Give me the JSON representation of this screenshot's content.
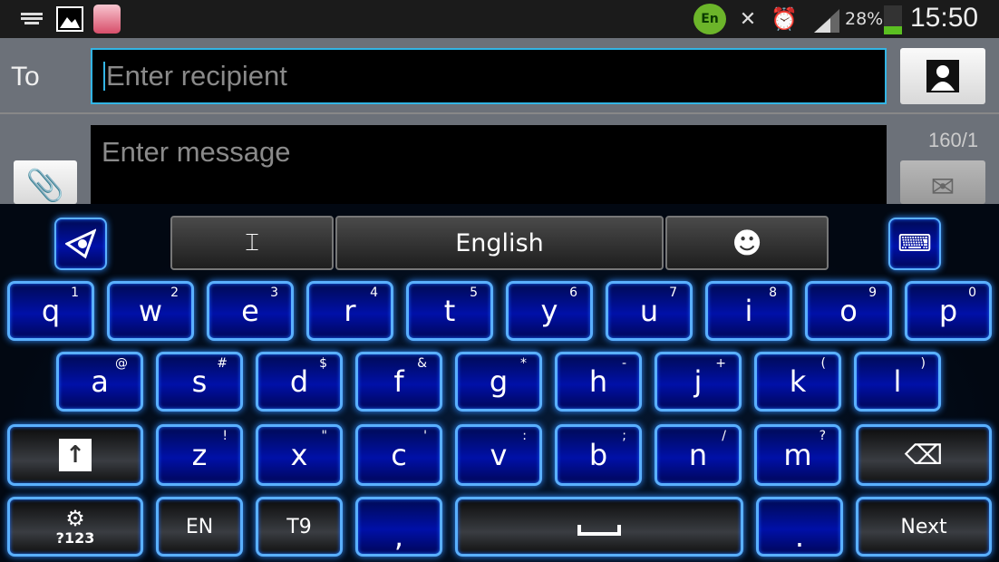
{
  "status_bar": {
    "battery": "28%",
    "time": "15:50",
    "language_badge": "En",
    "icons": [
      "keyboard-icon",
      "gallery-icon",
      "app-notification-icon",
      "language-icon",
      "mute-icon",
      "alarm-icon",
      "signal-icon",
      "battery-icon"
    ],
    "battery_color": "#5bbf21"
  },
  "compose": {
    "to_label": "To",
    "recipient_placeholder": "Enter recipient",
    "message_placeholder": "Enter message",
    "char_counter": "160/1",
    "accent": "#33b5e5"
  },
  "keyboard": {
    "toolbar": {
      "language": "English"
    },
    "rows": [
      [
        [
          "q",
          "1"
        ],
        [
          "w",
          "2"
        ],
        [
          "e",
          "3"
        ],
        [
          "r",
          "4"
        ],
        [
          "t",
          "5"
        ],
        [
          "y",
          "6"
        ],
        [
          "u",
          "7"
        ],
        [
          "i",
          "8"
        ],
        [
          "o",
          "9"
        ],
        [
          "p",
          "0"
        ]
      ],
      [
        [
          "a",
          "@"
        ],
        [
          "s",
          "#"
        ],
        [
          "d",
          "$"
        ],
        [
          "f",
          "&"
        ],
        [
          "g",
          "*"
        ],
        [
          "h",
          "-"
        ],
        [
          "j",
          "+"
        ],
        [
          "k",
          "("
        ],
        [
          "l",
          ")"
        ]
      ],
      [
        [
          "z",
          "!"
        ],
        [
          "x",
          "\""
        ],
        [
          "c",
          "'"
        ],
        [
          "v",
          ":"
        ],
        [
          "b",
          ";"
        ],
        [
          "n",
          "/"
        ],
        [
          "m",
          "?"
        ]
      ]
    ],
    "symbols_label": "?123",
    "lang_label": "EN",
    "t9_label": "T9",
    "comma": ",",
    "period": ".",
    "next_label": "Next",
    "key_color": "#0010a8",
    "glow_color": "#5ab0ff"
  }
}
